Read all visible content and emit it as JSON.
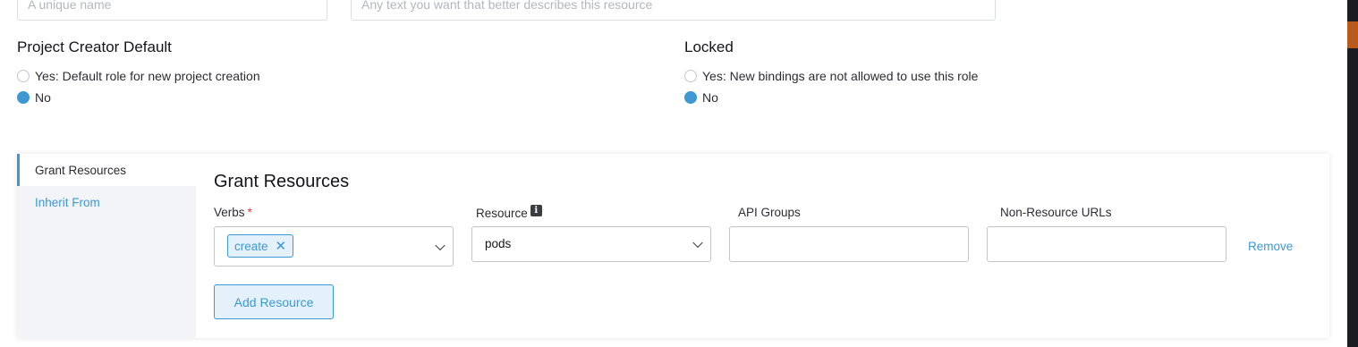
{
  "form": {
    "name_placeholder": "A unique name",
    "description_placeholder": "Any text you want that better describes this resource"
  },
  "project_creator_default": {
    "title": "Project Creator Default",
    "options": [
      {
        "label": "Yes: Default role for new project creation",
        "checked": false
      },
      {
        "label": "No",
        "checked": true
      }
    ]
  },
  "locked": {
    "title": "Locked",
    "options": [
      {
        "label": "Yes: New bindings are not allowed to use this role",
        "checked": false
      },
      {
        "label": "No",
        "checked": true
      }
    ]
  },
  "sidebar": {
    "items": [
      {
        "label": "Grant Resources",
        "active": true
      },
      {
        "label": "Inherit From",
        "active": false
      }
    ]
  },
  "grant": {
    "title": "Grant Resources",
    "verbs_label": "Verbs",
    "required_mark": "*",
    "verbs_selected": [
      "create"
    ],
    "resource_label": "Resource",
    "resource_value": "pods",
    "api_groups_label": "API Groups",
    "api_groups_value": "",
    "non_resource_urls_label": "Non-Resource URLs",
    "non_resource_urls_value": "",
    "remove_label": "Remove",
    "add_resource_label": "Add Resource"
  },
  "colors": {
    "accent": "#3d98d3",
    "required": "#e0343b",
    "scrollbar_accent": "#b85a1c"
  }
}
